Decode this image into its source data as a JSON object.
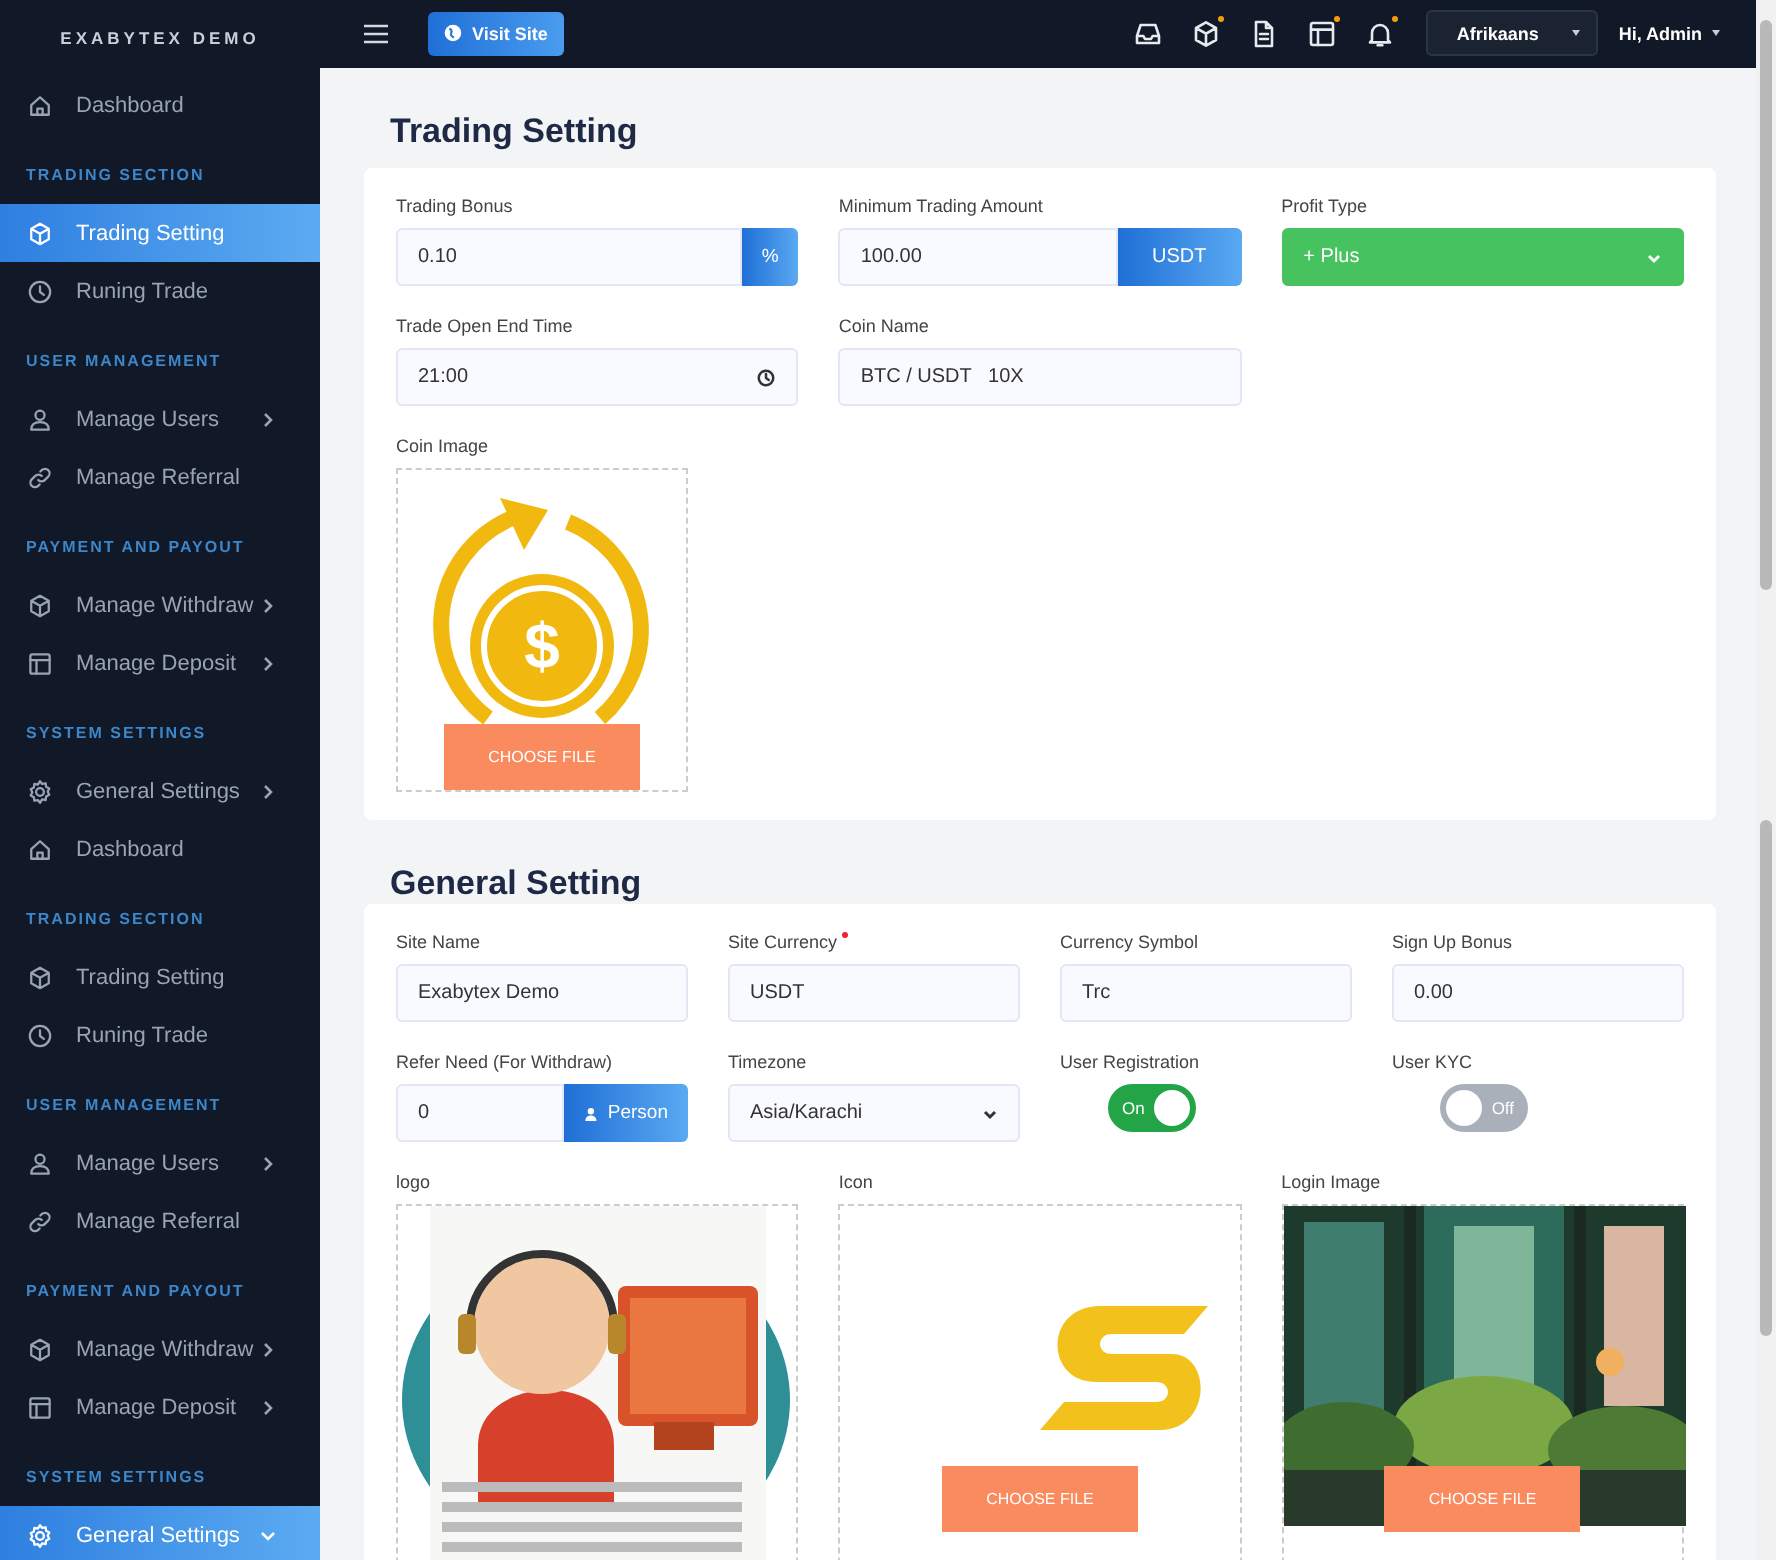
{
  "views": [
    {
      "header": {
        "brand": "EXABYTEX DEMO",
        "visit_site": "Visit Site",
        "icons": [
          {
            "badge": false
          },
          {
            "badge": true
          },
          {
            "badge": false
          },
          {
            "badge": true
          },
          {
            "badge": true
          }
        ],
        "language": "Afrikaans",
        "user": "Hi, Admin"
      },
      "sidebar": [
        {
          "kind": "link",
          "label": "Dashboard",
          "selected": false
        },
        {
          "kind": "heading",
          "label": "TRADING SECTION"
        },
        {
          "kind": "link",
          "label": "Trading Setting",
          "selected": true
        },
        {
          "kind": "link",
          "label": "Runing Trade",
          "selected": false
        },
        {
          "kind": "heading",
          "label": "USER MANAGEMENT"
        },
        {
          "kind": "link",
          "label": "Manage Users",
          "selected": false,
          "expanded": false
        },
        {
          "kind": "link",
          "label": "Manage Referral",
          "selected": false
        },
        {
          "kind": "heading",
          "label": "PAYMENT AND PAYOUT"
        },
        {
          "kind": "link",
          "label": "Manage Withdraw",
          "selected": false,
          "expanded": false
        },
        {
          "kind": "link",
          "label": "Manage Deposit",
          "selected": false,
          "expanded": false
        },
        {
          "kind": "heading",
          "label": "SYSTEM SETTINGS"
        },
        {
          "kind": "link",
          "label": "General Settings",
          "selected": false,
          "expanded": false
        }
      ],
      "title": "Trading Setting",
      "rows": [
        [
          {
            "kind": "addon",
            "label": "Trading Bonus",
            "value": "0.10",
            "addon": "%"
          },
          {
            "kind": "addon",
            "label": "Minimum Trading Amount",
            "value": "100.00",
            "addon": "USDT"
          },
          {
            "kind": "select",
            "label": "Profit Type",
            "value": "+ Plus",
            "color": "#46c35f"
          }
        ],
        [
          {
            "kind": "time",
            "label": "Trade Open End Time",
            "value": "21:00"
          },
          {
            "kind": "text",
            "label": "Coin Name",
            "value": "BTC / USDT   10X"
          }
        ]
      ],
      "uploads": [
        {
          "kind": "upload",
          "label": "Coin Image",
          "symbol": "$",
          "button": "CHOOSE FILE"
        }
      ]
    },
    {
      "sidebar": [
        {
          "kind": "link",
          "label": "Dashboard",
          "selected": false
        },
        {
          "kind": "heading",
          "label": "TRADING SECTION"
        },
        {
          "kind": "link",
          "label": "Trading Setting",
          "selected": false
        },
        {
          "kind": "link",
          "label": "Runing Trade",
          "selected": false
        },
        {
          "kind": "heading",
          "label": "USER MANAGEMENT"
        },
        {
          "kind": "link",
          "label": "Manage Users",
          "selected": false,
          "expanded": false
        },
        {
          "kind": "link",
          "label": "Manage Referral",
          "selected": false
        },
        {
          "kind": "heading",
          "label": "PAYMENT AND PAYOUT"
        },
        {
          "kind": "link",
          "label": "Manage Withdraw",
          "selected": false,
          "expanded": false
        },
        {
          "kind": "link",
          "label": "Manage Deposit",
          "selected": false,
          "expanded": false
        },
        {
          "kind": "heading",
          "label": "SYSTEM SETTINGS"
        },
        {
          "kind": "link",
          "label": "General Settings",
          "selected": true,
          "expanded": true
        }
      ],
      "title": "General Setting",
      "rows": [
        [
          {
            "kind": "text",
            "label": "Site Name",
            "value": "Exabytex Demo"
          },
          {
            "kind": "text",
            "label": "Site Currency",
            "value": "USDT",
            "required": true
          },
          {
            "kind": "text",
            "label": "Currency Symbol",
            "value": "Trc"
          },
          {
            "kind": "text",
            "label": "Sign Up Bonus",
            "value": "0.00"
          }
        ],
        [
          {
            "kind": "button-addon",
            "label": "Refer Need (For Withdraw)",
            "value": "0",
            "addon": "Person"
          },
          {
            "kind": "select",
            "label": "Timezone",
            "value": "Asia/Karachi"
          },
          {
            "kind": "toggle",
            "label": "User Registration",
            "on": true,
            "text": "On"
          },
          {
            "kind": "toggle",
            "label": "User KYC",
            "on": false,
            "text": "Off"
          }
        ]
      ],
      "uploads": [
        {
          "kind": "upload",
          "label": "logo"
        },
        {
          "kind": "upload",
          "label": "Icon",
          "button": "CHOOSE FILE"
        },
        {
          "kind": "upload",
          "label": "Login Image",
          "button": "CHOOSE FILE"
        }
      ]
    }
  ]
}
